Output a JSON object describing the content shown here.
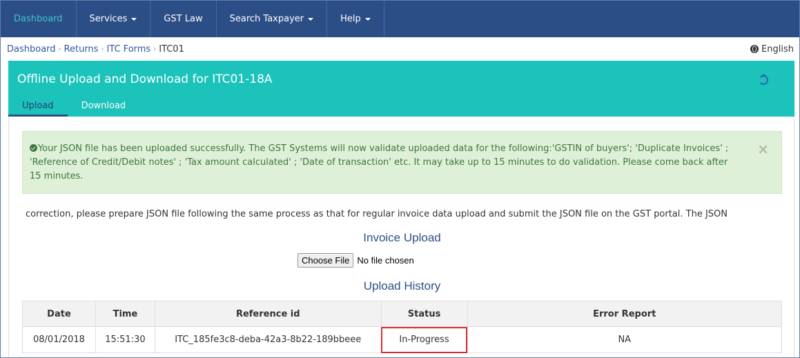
{
  "navbar": {
    "items": [
      {
        "label": "Dashboard",
        "dropdown": false,
        "active": true
      },
      {
        "label": "Services",
        "dropdown": true
      },
      {
        "label": "GST Law",
        "dropdown": false
      },
      {
        "label": "Search Taxpayer",
        "dropdown": true
      },
      {
        "label": "Help",
        "dropdown": true
      }
    ]
  },
  "breadcrumb": {
    "items": [
      "Dashboard",
      "Returns",
      "ITC Forms"
    ],
    "current": "ITC01",
    "language": "English"
  },
  "panel": {
    "title": "Offline Upload and Download for  ITC01-18A",
    "tabs": [
      "Upload",
      "Download"
    ],
    "active_tab": "Upload"
  },
  "alert": {
    "message": "Your JSON file has been uploaded successfully. The GST Systems will now validate uploaded data for the following:'GSTIN of buyers'; 'Duplicate Invoices' ; 'Reference of Credit/Debit notes' ; 'Tax amount calculated' ; 'Date of transaction' etc. It may take up to 15 minutes to do validation. Please come back after 15 minutes.",
    "close": "×"
  },
  "marquee": {
    "text": "correction, please prepare JSON file following the same process as that for regular invoice data upload and submit the JSON file on the GST portal. The JSON"
  },
  "invoice_upload": {
    "title": "Invoice Upload",
    "button": "Choose File",
    "status": "No file chosen"
  },
  "upload_history": {
    "title": "Upload History",
    "columns": [
      "Date",
      "Time",
      "Reference id",
      "Status",
      "Error Report"
    ],
    "rows": [
      {
        "date": "08/01/2018",
        "time": "15:51:30",
        "reference_id": "ITC_185fe3c8-deba-42a3-8b22-189bbeee",
        "status": "In-Progress",
        "error_report": "NA"
      }
    ]
  },
  "colors": {
    "navbar": "#2c4e86",
    "teal": "#1bc3bb",
    "alert_bg": "#dff0d8",
    "highlight": "#d42f2f"
  }
}
